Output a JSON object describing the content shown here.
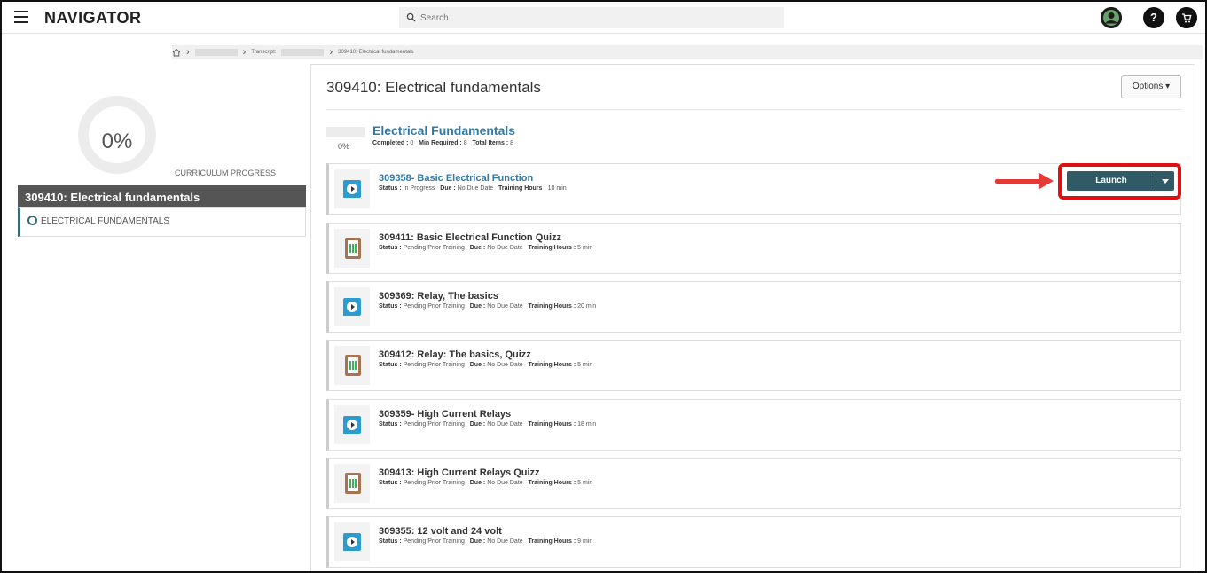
{
  "header": {
    "brand": "NAVIGATOR",
    "search_placeholder": "Search",
    "help_label": "?"
  },
  "breadcrumb": {
    "transcript_label": "Transcript:",
    "current": "309410: Electrical fundamentals"
  },
  "sidebar": {
    "progress_percent": "0%",
    "progress_fraction": 0,
    "progress_label": "CURRICULUM PROGRESS",
    "curriculum_title": "309410: Electrical fundamentals",
    "sections": [
      {
        "label": "ELECTRICAL FUNDAMENTALS"
      }
    ]
  },
  "main": {
    "title": "309410: Electrical fundamentals",
    "options_label": "Options",
    "section": {
      "title": "Electrical Fundamentals",
      "percent": "0%",
      "completed_label": "Completed :",
      "completed_value": "0",
      "min_required_label": "Min Required :",
      "min_required_value": "8",
      "total_items_label": "Total Items :",
      "total_items_value": "8"
    },
    "meta_labels": {
      "status": "Status :",
      "due": "Due :",
      "hours": "Training Hours :"
    },
    "items": [
      {
        "title": "309358- Basic Electrical Function",
        "type": "video",
        "status": "In Progress",
        "due": "No Due Date",
        "hours": "10 min"
      },
      {
        "title": "309411: Basic Electrical Function Quizz",
        "type": "quiz",
        "status": "Pending Prior Training",
        "due": "No Due Date",
        "hours": "5 min"
      },
      {
        "title": "309369: Relay, The basics",
        "type": "video",
        "status": "Pending Prior Training",
        "due": "No Due Date",
        "hours": "20 min"
      },
      {
        "title": "309412: Relay: The basics, Quizz",
        "type": "quiz",
        "status": "Pending Prior Training",
        "due": "No Due Date",
        "hours": "5 min"
      },
      {
        "title": "309359- High Current Relays",
        "type": "video",
        "status": "Pending Prior Training",
        "due": "No Due Date",
        "hours": "18 min"
      },
      {
        "title": "309413: High Current Relays Quizz",
        "type": "quiz",
        "status": "Pending Prior Training",
        "due": "No Due Date",
        "hours": "5 min"
      },
      {
        "title": "309355: 12 volt and 24 volt",
        "type": "video",
        "status": "Pending Prior Training",
        "due": "No Due Date",
        "hours": "9 min"
      }
    ],
    "launch_label": "Launch"
  },
  "colors": {
    "link": "#2f7aa6",
    "launch": "#2f5a66",
    "highlight": "#e01010",
    "video_icon": "#2b9bd0"
  }
}
